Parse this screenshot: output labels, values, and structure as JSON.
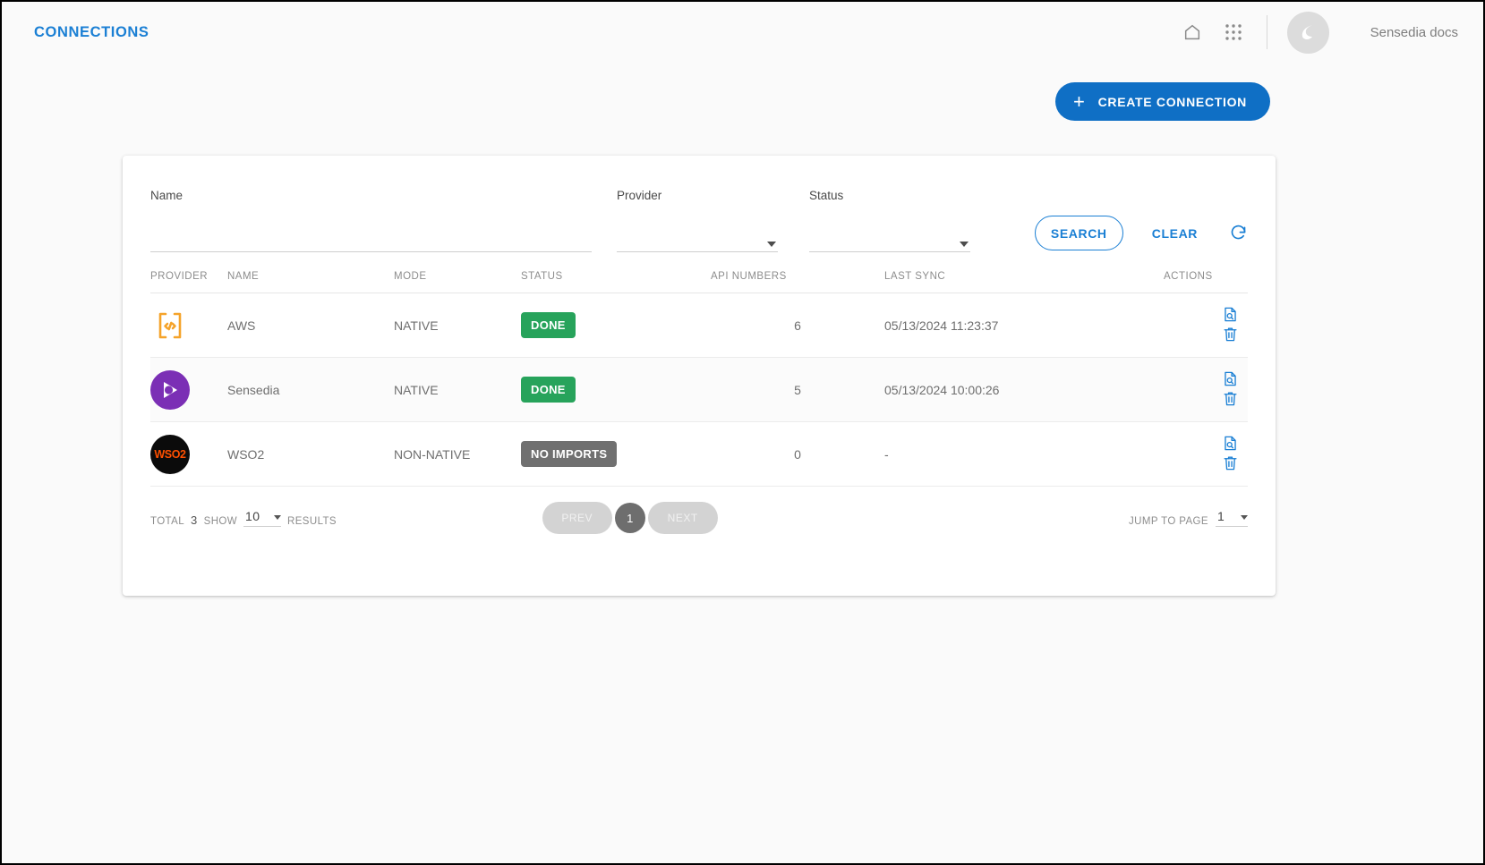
{
  "header": {
    "title": "CONNECTIONS",
    "home_icon": "home-icon",
    "apps_icon": "apps-grid-icon",
    "avatar_icon": "sensedia-logo-avatar",
    "user_label": "Sensedia docs"
  },
  "toolbar": {
    "create_label": "CREATE CONNECTION",
    "plus_icon": "plus-icon"
  },
  "filters": {
    "name_label": "Name",
    "name_value": "",
    "name_placeholder": "",
    "provider_label": "Provider",
    "provider_value": "",
    "status_label": "Status",
    "status_value": "",
    "search_label": "SEARCH",
    "clear_label": "CLEAR",
    "refresh_icon": "refresh-icon"
  },
  "table": {
    "columns": [
      "PROVIDER",
      "NAME",
      "MODE",
      "STATUS",
      "API NUMBERS",
      "LAST SYNC",
      "ACTIONS"
    ],
    "rows": [
      {
        "provider_icon": "aws-code-brackets-icon",
        "name": "AWS",
        "mode": "NATIVE",
        "status": "DONE",
        "status_kind": "done",
        "api_numbers": "6",
        "last_sync": "05/13/2024 11:23:37",
        "view_icon": "document-search-icon",
        "delete_icon": "trash-icon"
      },
      {
        "provider_icon": "sensedia-logo-icon",
        "name": "Sensedia",
        "mode": "NATIVE",
        "status": "DONE",
        "status_kind": "done",
        "api_numbers": "5",
        "last_sync": "05/13/2024 10:00:26",
        "view_icon": "document-search-icon",
        "delete_icon": "trash-icon"
      },
      {
        "provider_icon": "wso2-logo-icon",
        "name": "WSO2",
        "mode": "NON-NATIVE",
        "status": "NO IMPORTS",
        "status_kind": "noimports",
        "api_numbers": "0",
        "last_sync": "-",
        "view_icon": "document-search-icon",
        "delete_icon": "trash-icon"
      }
    ]
  },
  "pagination": {
    "total_label": "TOTAL",
    "total_value": "3",
    "show_label": "SHOW",
    "show_value": "10",
    "results_label": "RESULTS",
    "prev_label": "PREV",
    "current_page": "1",
    "next_label": "NEXT",
    "jump_label": "JUMP TO PAGE",
    "jump_value": "1"
  },
  "colors": {
    "accent": "#1a7fd4",
    "primary_button": "#0f6fc5",
    "status_done": "#27a35b",
    "status_noimports": "#707070",
    "aws_icon": "#f5a32a",
    "sensedia_purple": "#7b2fb5",
    "wso2_orange": "#ff5000"
  }
}
